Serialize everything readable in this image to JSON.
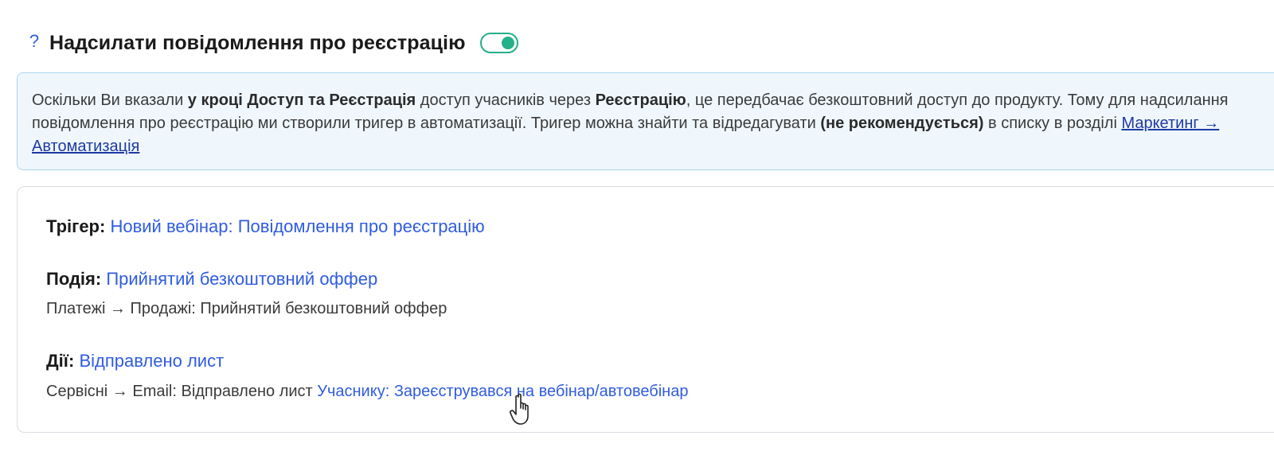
{
  "header": {
    "help_icon": "?",
    "title": "Надсилати повідомлення про реєстрацію",
    "toggle_state": "on",
    "toggle_color": "#23b08a"
  },
  "info": {
    "t1": "Оскільки Ви вказали ",
    "b1": "у кроці Доступ та Реєстрація",
    "t2": " доступ учасників через ",
    "b2": "Реєстрацію",
    "t3": ", це передбачає безкоштовний доступ до продукту. Тому для надсилання повідомлення про реєстрацію ми створили тригер в автоматизації. Тригер можна знайти та відредагувати ",
    "b3": "(не рекомендується)",
    "t4": " в списку в розділі ",
    "link": "Маркетинг → Автоматизація"
  },
  "card": {
    "trigger_label": "Трігер:",
    "trigger_value": "Новий вебінар: Повідомлення про реєстрацію",
    "event_label": "Подія:",
    "event_value": "Прийнятий безкоштовний оффер",
    "event_path": "Платежі → Продажі: Прийнятий безкоштовний оффер",
    "actions_label": "Дії:",
    "actions_value": "Відправлено лист",
    "actions_path": "Сервісні → Email: Відправлено лист ",
    "actions_link": "Учаснику: Зареєструвався на вебінар/автовебінар"
  },
  "colors": {
    "link": "#2f5ce0",
    "info_bg": "#f0f7fc",
    "info_border": "#a9d5ee",
    "toggle": "#23b08a"
  },
  "icons": {
    "help": "help-icon",
    "cursor": "hand-pointer-icon"
  }
}
